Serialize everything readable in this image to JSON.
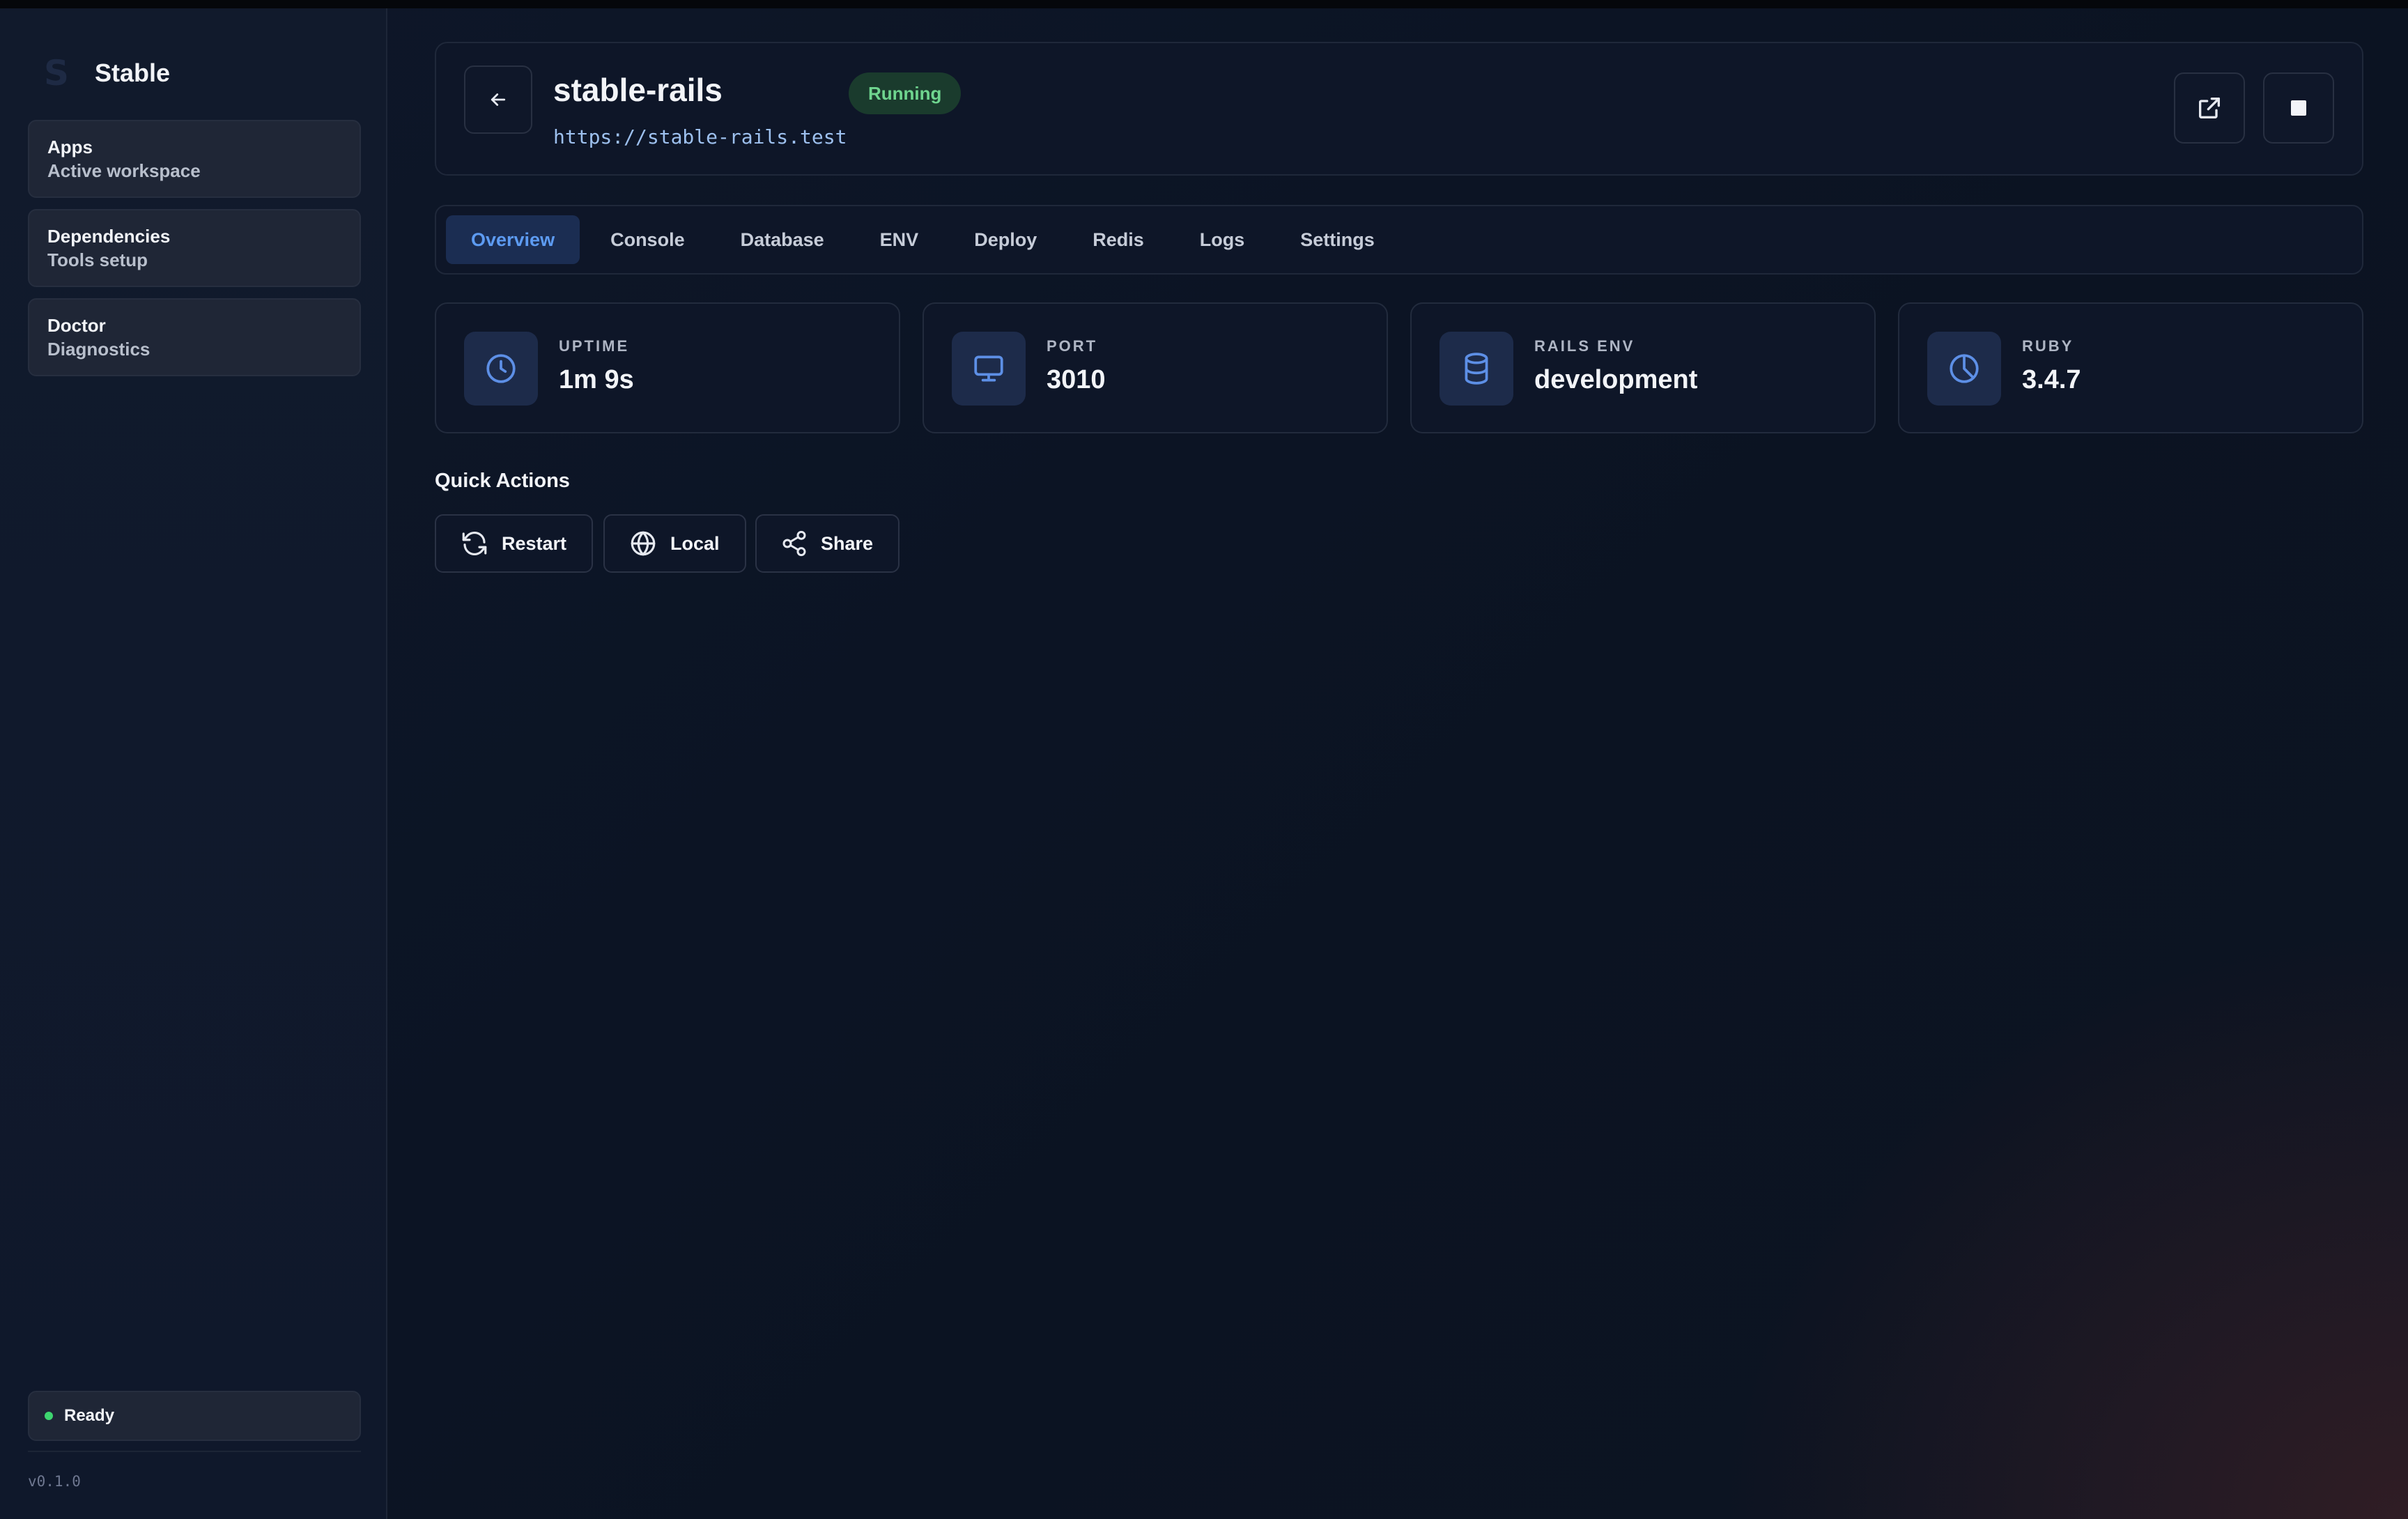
{
  "app": {
    "brand_letter": "S",
    "brand_name": "Stable"
  },
  "sidebar": {
    "items": [
      {
        "title": "Apps",
        "subtitle": "Active workspace"
      },
      {
        "title": "Dependencies",
        "subtitle": "Tools setup"
      },
      {
        "title": "Doctor",
        "subtitle": "Diagnostics"
      }
    ],
    "status": {
      "label": "Ready",
      "color": "#3dd56f"
    },
    "version": "v0.1.0"
  },
  "header": {
    "title": "stable-rails",
    "url": "https://stable-rails.test",
    "status_badge": "Running",
    "icons": {
      "back": "arrow-left-icon",
      "open": "external-link-icon",
      "stop": "stop-icon"
    }
  },
  "tabs": [
    {
      "label": "Overview",
      "active": true
    },
    {
      "label": "Console",
      "active": false
    },
    {
      "label": "Database",
      "active": false
    },
    {
      "label": "ENV",
      "active": false
    },
    {
      "label": "Deploy",
      "active": false
    },
    {
      "label": "Redis",
      "active": false
    },
    {
      "label": "Logs",
      "active": false
    },
    {
      "label": "Settings",
      "active": false
    }
  ],
  "stats": [
    {
      "label": "UPTIME",
      "value": "1m 9s",
      "icon": "clock-icon"
    },
    {
      "label": "PORT",
      "value": "3010",
      "icon": "monitor-icon"
    },
    {
      "label": "RAILS ENV",
      "value": "development",
      "icon": "database-icon"
    },
    {
      "label": "RUBY",
      "value": "3.4.7",
      "icon": "pie-clock-icon"
    }
  ],
  "quick_actions": {
    "title": "Quick Actions",
    "buttons": [
      {
        "label": "Restart",
        "icon": "refresh-icon"
      },
      {
        "label": "Local",
        "icon": "globe-icon"
      },
      {
        "label": "Share",
        "icon": "share-icon"
      }
    ]
  },
  "colors": {
    "accent": "#5d9bf2",
    "running": "#6fd58f",
    "ready": "#3dd56f"
  }
}
